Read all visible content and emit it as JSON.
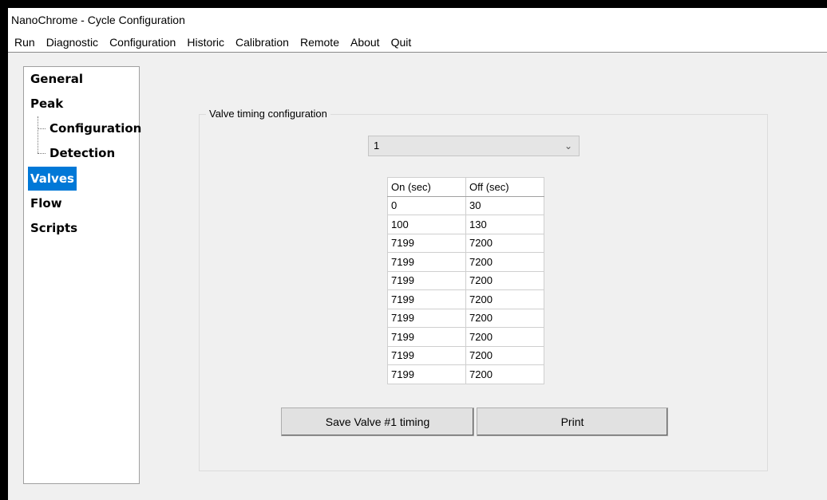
{
  "window": {
    "title": "NanoChrome - Cycle Configuration"
  },
  "menu": [
    "Run",
    "Diagnostic",
    "Configuration",
    "Historic",
    "Calibration",
    "Remote",
    "About",
    "Quit"
  ],
  "tree": {
    "general": "General",
    "peak": "Peak",
    "configuration": "Configuration",
    "detection": "Detection",
    "valves": "Valves",
    "flow": "Flow",
    "scripts": "Scripts",
    "selected": "Valves"
  },
  "valve_group": {
    "title": "Valve timing configuration",
    "valve_select": "1",
    "table": {
      "headers": [
        "On (sec)",
        "Off (sec)"
      ],
      "rows": [
        [
          "0",
          "30"
        ],
        [
          "100",
          "130"
        ],
        [
          "7199",
          "7200"
        ],
        [
          "7199",
          "7200"
        ],
        [
          "7199",
          "7200"
        ],
        [
          "7199",
          "7200"
        ],
        [
          "7199",
          "7200"
        ],
        [
          "7199",
          "7200"
        ],
        [
          "7199",
          "7200"
        ],
        [
          "7199",
          "7200"
        ]
      ]
    },
    "save_button": "Save Valve #1 timing",
    "print_button": "Print"
  },
  "colors": {
    "selection": "#0078d7"
  }
}
